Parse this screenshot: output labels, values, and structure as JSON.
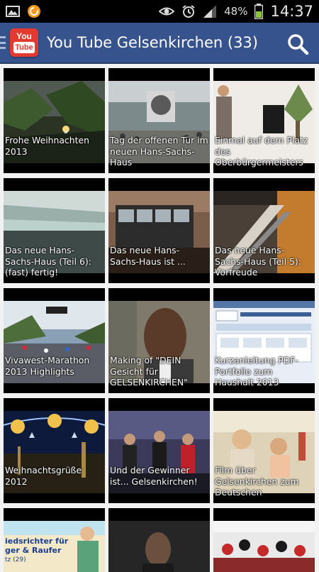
{
  "status_bar": {
    "battery_percent": "48%",
    "time": "14:37",
    "icons": [
      "gallery-icon",
      "sync-app-icon",
      "eye-icon",
      "alarm-icon",
      "signal-icon",
      "battery-icon"
    ]
  },
  "app_bar": {
    "logo_top": "You",
    "logo_bottom": "Tube",
    "title": "You Tube Gelsenkirchen (33)"
  },
  "videos": [
    {
      "title": "Frohe Weihnachten 2013"
    },
    {
      "title": "Tag der offenen Tür im neuen Hans-Sachs-Haus"
    },
    {
      "title": "Einmal auf dem Platz des Oberbürgermeisters"
    },
    {
      "title": "Das neue Hans-Sachs-Haus (Teil 6): (fast) fertig!"
    },
    {
      "title": "Das neue Hans-Sachs-Haus ist ..."
    },
    {
      "title": "Das neue Hans-Sachs-Haus (Teil 5): Vorfreude"
    },
    {
      "title": "Vivawest-Marathon 2013 Highlights"
    },
    {
      "title": "Making of \"DEIN Gesicht für GELSENKIRCHEN\""
    },
    {
      "title": "Kurzanleitung PDF-Portfolio zum Haushalt 2013"
    },
    {
      "title": "Weihnachtsgrüße 2012"
    },
    {
      "title": "Und der Gewinner ist... Gelsenkirchen!"
    },
    {
      "title": "Film über Gelsenkirchen zum Deutschen"
    }
  ],
  "partial_row_thumb_text": "iedsrichter für ger & Raufer",
  "partial_row_thumb_small": "tz (29)"
}
